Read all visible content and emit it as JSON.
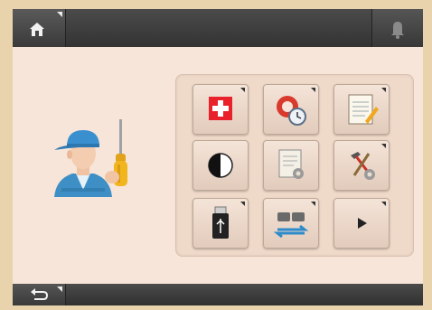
{
  "header": {
    "home_icon": "home-icon",
    "bell_icon": "bell-icon"
  },
  "footer": {
    "back_icon": "back-arrow-icon"
  },
  "illustration": {
    "icon": "technician-icon"
  },
  "menu": {
    "tiles": [
      {
        "icon": "first-aid-icon"
      },
      {
        "icon": "service-alarm-icon"
      },
      {
        "icon": "notes-icon"
      },
      {
        "icon": "contrast-icon"
      },
      {
        "icon": "settings-document-icon"
      },
      {
        "icon": "tools-icon"
      },
      {
        "icon": "usb-icon"
      },
      {
        "icon": "transfer-icon"
      },
      {
        "icon": "play-icon"
      }
    ]
  },
  "colors": {
    "background": "#e9d3ac",
    "screen": "#f6e5d8",
    "bar": "#3c3c3c",
    "accent_red": "#e8212b"
  }
}
